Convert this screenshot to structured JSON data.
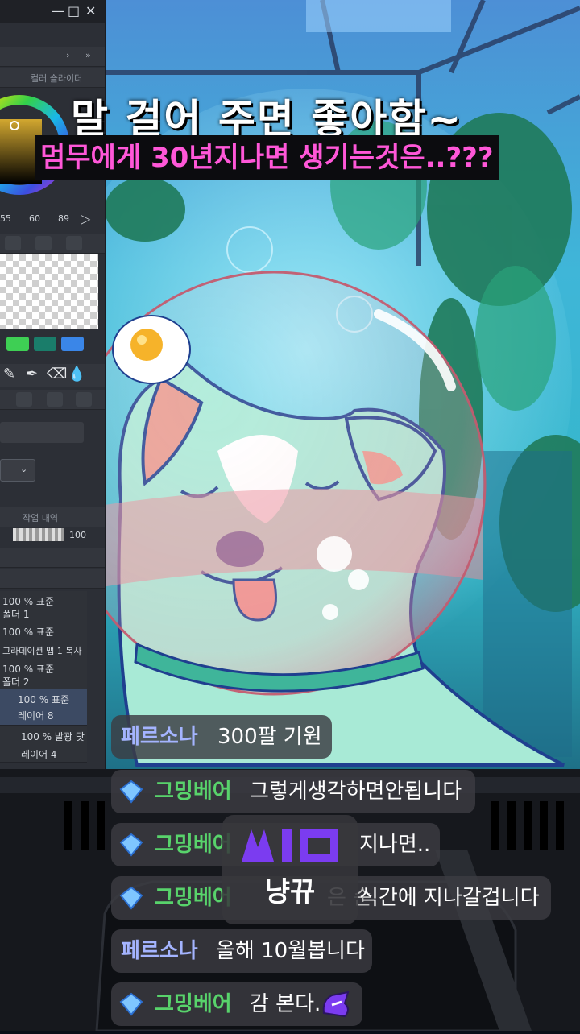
{
  "window": {
    "controls": [
      "—",
      "□",
      "✕"
    ]
  },
  "color_panel": {
    "tab_label": "컬러 슬라이더",
    "values": [
      "55",
      "60",
      "89"
    ],
    "accent": "#b0883a"
  },
  "swatches": [
    "#3ecf54",
    "#1a7d6a",
    "#3a86e8"
  ],
  "layers_panel": {
    "header": "작업 내역",
    "opacity_value": "100",
    "rows": [
      {
        "line1": "100 % 표준",
        "line2": "폴더 1"
      },
      {
        "line1": "100 % 표준",
        "line2": ""
      },
      {
        "line1": "그라데이션 맵 1 복사",
        "line2": ""
      },
      {
        "line1": "100 % 표준",
        "line2": "폴더 2"
      },
      {
        "line1": "100 % 표준",
        "line2": "레이어 8"
      },
      {
        "line1": "100 % 발광 닷",
        "line2": "레이어 4"
      }
    ]
  },
  "captions": {
    "top": "말 걸어 주면 좋아함~",
    "sub": "멈무에게 30년지나면 생기는것은..???"
  },
  "chat": [
    {
      "name": "페르소나",
      "message": "300팔 기원",
      "name_color": "blue",
      "gem": false
    },
    {
      "name": "그밍베어",
      "message": "그렇게생각하면안됩니다",
      "name_color": "green",
      "gem": true
    },
    {
      "name": "그밍베어",
      "message": "지나면..",
      "name_color": "green",
      "gem": true
    },
    {
      "name": "그밍베어",
      "message": "식간에 지나갈겁니다",
      "name_color": "green",
      "gem": true
    },
    {
      "name": "페르소나",
      "message": "올해 10월봅니다",
      "name_color": "blue",
      "gem": false
    },
    {
      "name": "그밍베어",
      "message": "감 본다.",
      "name_color": "green",
      "gem": true
    }
  ],
  "chat_fragment": "은 순",
  "logo": {
    "mark": "ㅆㅣㅁㅣ",
    "label": "냥뀨",
    "mark_color": "#7b3cf0"
  }
}
